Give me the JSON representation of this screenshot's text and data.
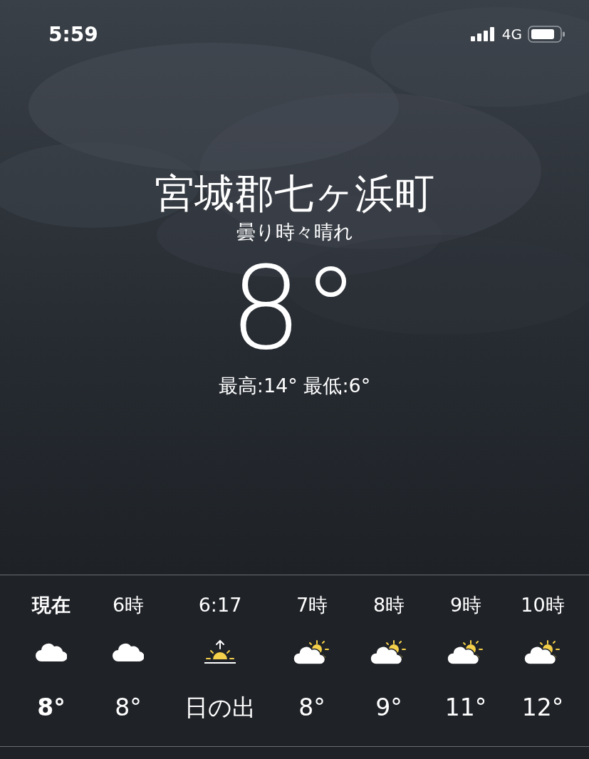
{
  "status_bar": {
    "time": "5:59",
    "network": "4G"
  },
  "location": "宮城郡七ヶ浜町",
  "condition": "曇り時々晴れ",
  "temperature": "8°",
  "high_low": "最高:14° 最低:6°",
  "hourly": [
    {
      "time": "現在",
      "kind": "cloud",
      "temp": "8°",
      "current": true
    },
    {
      "time": "6時",
      "kind": "cloud",
      "temp": "8°",
      "current": false
    },
    {
      "time": "6:17",
      "kind": "sunrise",
      "temp": "日の出",
      "current": false
    },
    {
      "time": "7時",
      "kind": "partly-sunny",
      "temp": "8°",
      "current": false
    },
    {
      "time": "8時",
      "kind": "partly-sunny",
      "temp": "9°",
      "current": false
    },
    {
      "time": "9時",
      "kind": "partly-sunny",
      "temp": "11°",
      "current": false
    },
    {
      "time": "10時",
      "kind": "partly-sunny",
      "temp": "12°",
      "current": false
    }
  ]
}
